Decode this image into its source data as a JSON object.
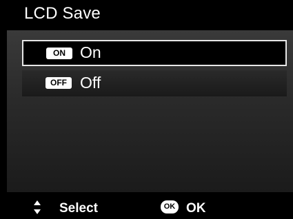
{
  "header": {
    "title": "LCD Save"
  },
  "options": [
    {
      "badge": "ON",
      "label": "On",
      "selected": true
    },
    {
      "badge": "OFF",
      "label": "Off",
      "selected": false
    }
  ],
  "footer": {
    "navigate_icon": "up-down-arrows-icon",
    "select_label": "Select",
    "ok_icon_text": "OK",
    "ok_label": "OK"
  },
  "colors": {
    "background": "#000000",
    "panel": "#2b2b2b",
    "highlight_border": "#e8e8e8",
    "text": "#ffffff"
  }
}
